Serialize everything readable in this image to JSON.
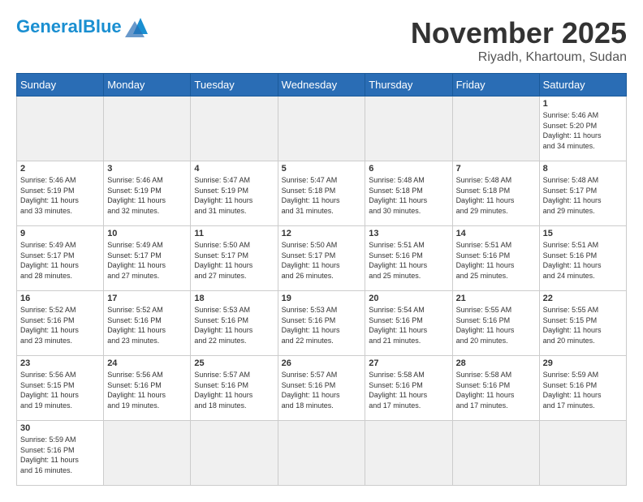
{
  "header": {
    "logo_general": "General",
    "logo_blue": "Blue",
    "month": "November 2025",
    "location": "Riyadh, Khartoum, Sudan"
  },
  "days_of_week": [
    "Sunday",
    "Monday",
    "Tuesday",
    "Wednesday",
    "Thursday",
    "Friday",
    "Saturday"
  ],
  "weeks": [
    [
      {
        "day": "",
        "info": ""
      },
      {
        "day": "",
        "info": ""
      },
      {
        "day": "",
        "info": ""
      },
      {
        "day": "",
        "info": ""
      },
      {
        "day": "",
        "info": ""
      },
      {
        "day": "",
        "info": ""
      },
      {
        "day": "1",
        "info": "Sunrise: 5:46 AM\nSunset: 5:20 PM\nDaylight: 11 hours\nand 34 minutes."
      }
    ],
    [
      {
        "day": "2",
        "info": "Sunrise: 5:46 AM\nSunset: 5:19 PM\nDaylight: 11 hours\nand 33 minutes."
      },
      {
        "day": "3",
        "info": "Sunrise: 5:46 AM\nSunset: 5:19 PM\nDaylight: 11 hours\nand 32 minutes."
      },
      {
        "day": "4",
        "info": "Sunrise: 5:47 AM\nSunset: 5:19 PM\nDaylight: 11 hours\nand 31 minutes."
      },
      {
        "day": "5",
        "info": "Sunrise: 5:47 AM\nSunset: 5:18 PM\nDaylight: 11 hours\nand 31 minutes."
      },
      {
        "day": "6",
        "info": "Sunrise: 5:48 AM\nSunset: 5:18 PM\nDaylight: 11 hours\nand 30 minutes."
      },
      {
        "day": "7",
        "info": "Sunrise: 5:48 AM\nSunset: 5:18 PM\nDaylight: 11 hours\nand 29 minutes."
      },
      {
        "day": "8",
        "info": "Sunrise: 5:48 AM\nSunset: 5:17 PM\nDaylight: 11 hours\nand 29 minutes."
      }
    ],
    [
      {
        "day": "9",
        "info": "Sunrise: 5:49 AM\nSunset: 5:17 PM\nDaylight: 11 hours\nand 28 minutes."
      },
      {
        "day": "10",
        "info": "Sunrise: 5:49 AM\nSunset: 5:17 PM\nDaylight: 11 hours\nand 27 minutes."
      },
      {
        "day": "11",
        "info": "Sunrise: 5:50 AM\nSunset: 5:17 PM\nDaylight: 11 hours\nand 27 minutes."
      },
      {
        "day": "12",
        "info": "Sunrise: 5:50 AM\nSunset: 5:17 PM\nDaylight: 11 hours\nand 26 minutes."
      },
      {
        "day": "13",
        "info": "Sunrise: 5:51 AM\nSunset: 5:16 PM\nDaylight: 11 hours\nand 25 minutes."
      },
      {
        "day": "14",
        "info": "Sunrise: 5:51 AM\nSunset: 5:16 PM\nDaylight: 11 hours\nand 25 minutes."
      },
      {
        "day": "15",
        "info": "Sunrise: 5:51 AM\nSunset: 5:16 PM\nDaylight: 11 hours\nand 24 minutes."
      }
    ],
    [
      {
        "day": "16",
        "info": "Sunrise: 5:52 AM\nSunset: 5:16 PM\nDaylight: 11 hours\nand 23 minutes."
      },
      {
        "day": "17",
        "info": "Sunrise: 5:52 AM\nSunset: 5:16 PM\nDaylight: 11 hours\nand 23 minutes."
      },
      {
        "day": "18",
        "info": "Sunrise: 5:53 AM\nSunset: 5:16 PM\nDaylight: 11 hours\nand 22 minutes."
      },
      {
        "day": "19",
        "info": "Sunrise: 5:53 AM\nSunset: 5:16 PM\nDaylight: 11 hours\nand 22 minutes."
      },
      {
        "day": "20",
        "info": "Sunrise: 5:54 AM\nSunset: 5:16 PM\nDaylight: 11 hours\nand 21 minutes."
      },
      {
        "day": "21",
        "info": "Sunrise: 5:55 AM\nSunset: 5:16 PM\nDaylight: 11 hours\nand 20 minutes."
      },
      {
        "day": "22",
        "info": "Sunrise: 5:55 AM\nSunset: 5:15 PM\nDaylight: 11 hours\nand 20 minutes."
      }
    ],
    [
      {
        "day": "23",
        "info": "Sunrise: 5:56 AM\nSunset: 5:15 PM\nDaylight: 11 hours\nand 19 minutes."
      },
      {
        "day": "24",
        "info": "Sunrise: 5:56 AM\nSunset: 5:16 PM\nDaylight: 11 hours\nand 19 minutes."
      },
      {
        "day": "25",
        "info": "Sunrise: 5:57 AM\nSunset: 5:16 PM\nDaylight: 11 hours\nand 18 minutes."
      },
      {
        "day": "26",
        "info": "Sunrise: 5:57 AM\nSunset: 5:16 PM\nDaylight: 11 hours\nand 18 minutes."
      },
      {
        "day": "27",
        "info": "Sunrise: 5:58 AM\nSunset: 5:16 PM\nDaylight: 11 hours\nand 17 minutes."
      },
      {
        "day": "28",
        "info": "Sunrise: 5:58 AM\nSunset: 5:16 PM\nDaylight: 11 hours\nand 17 minutes."
      },
      {
        "day": "29",
        "info": "Sunrise: 5:59 AM\nSunset: 5:16 PM\nDaylight: 11 hours\nand 17 minutes."
      }
    ],
    [
      {
        "day": "30",
        "info": "Sunrise: 5:59 AM\nSunset: 5:16 PM\nDaylight: 11 hours\nand 16 minutes."
      },
      {
        "day": "",
        "info": ""
      },
      {
        "day": "",
        "info": ""
      },
      {
        "day": "",
        "info": ""
      },
      {
        "day": "",
        "info": ""
      },
      {
        "day": "",
        "info": ""
      },
      {
        "day": "",
        "info": ""
      }
    ]
  ]
}
